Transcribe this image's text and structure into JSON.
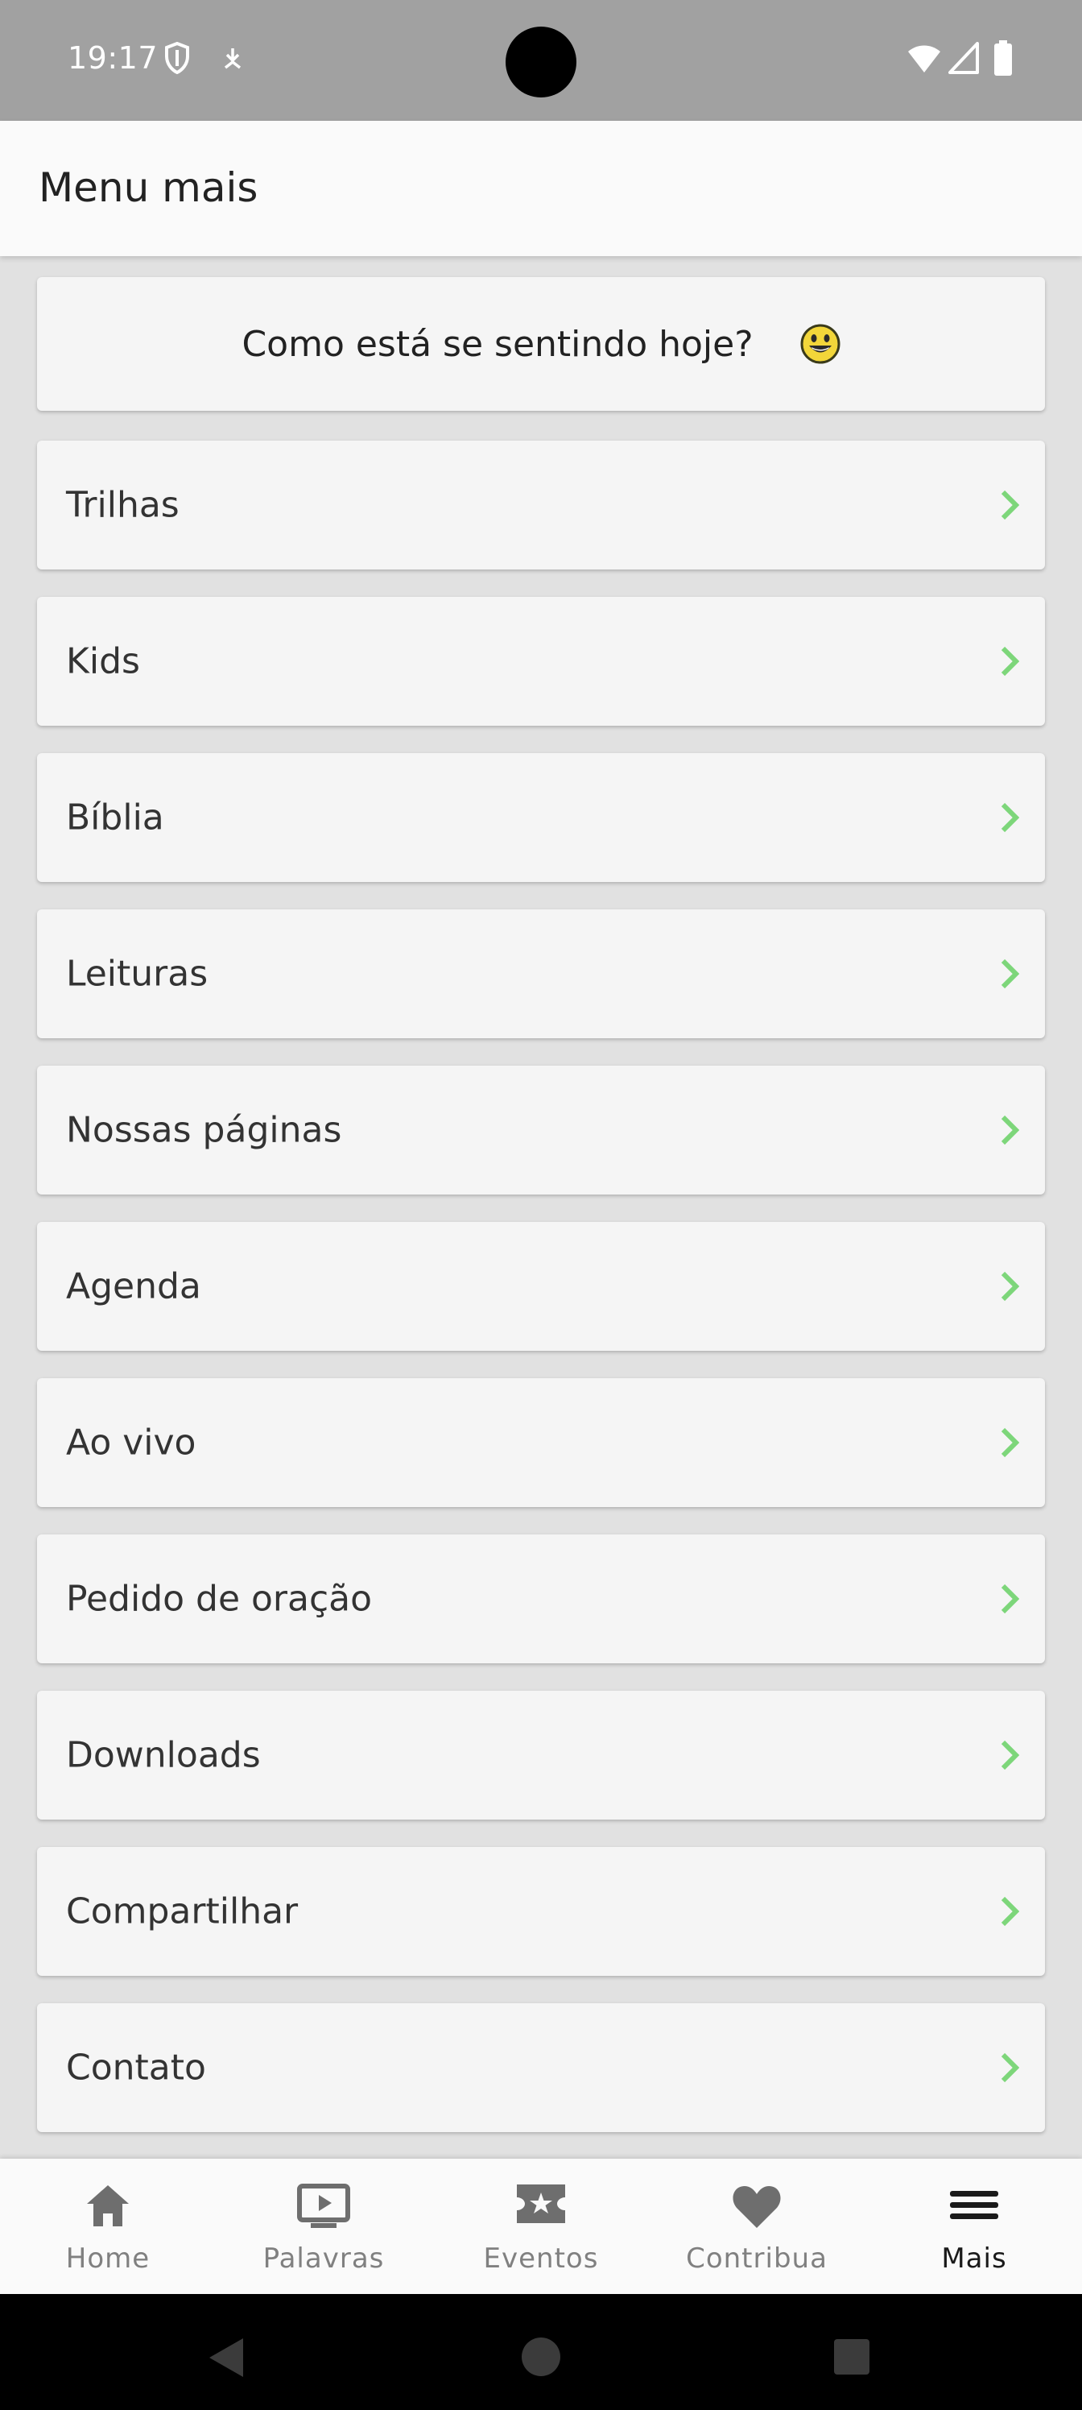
{
  "status_bar": {
    "time": "19:17",
    "icons": [
      "shield-icon",
      "download-icon",
      "wifi-icon",
      "signal-icon",
      "battery-icon"
    ]
  },
  "app_bar": {
    "title": "Menu mais"
  },
  "mood_prompt": {
    "text": "Como está se sentindo hoje?",
    "emoji": "😀"
  },
  "menu": {
    "items": [
      {
        "label": "Trilhas"
      },
      {
        "label": "Kids"
      },
      {
        "label": "Bíblia"
      },
      {
        "label": "Leituras"
      },
      {
        "label": "Nossas páginas"
      },
      {
        "label": "Agenda"
      },
      {
        "label": "Ao vivo"
      },
      {
        "label": "Pedido de oração"
      },
      {
        "label": "Downloads"
      },
      {
        "label": "Compartilhar"
      },
      {
        "label": "Contato"
      }
    ]
  },
  "bottom_nav": {
    "items": [
      {
        "label": "Home",
        "icon": "home-icon"
      },
      {
        "label": "Palavras",
        "icon": "tv-play-icon"
      },
      {
        "label": "Eventos",
        "icon": "ticket-star-icon"
      },
      {
        "label": "Contribua",
        "icon": "heart-icon"
      },
      {
        "label": "Mais",
        "icon": "menu-icon"
      }
    ],
    "active": "Mais"
  },
  "colors": {
    "accent_chevron": "#7dd67a",
    "status_bar": "#a1a1a1",
    "background": "#e1e1e1",
    "card": "#f5f5f5"
  }
}
